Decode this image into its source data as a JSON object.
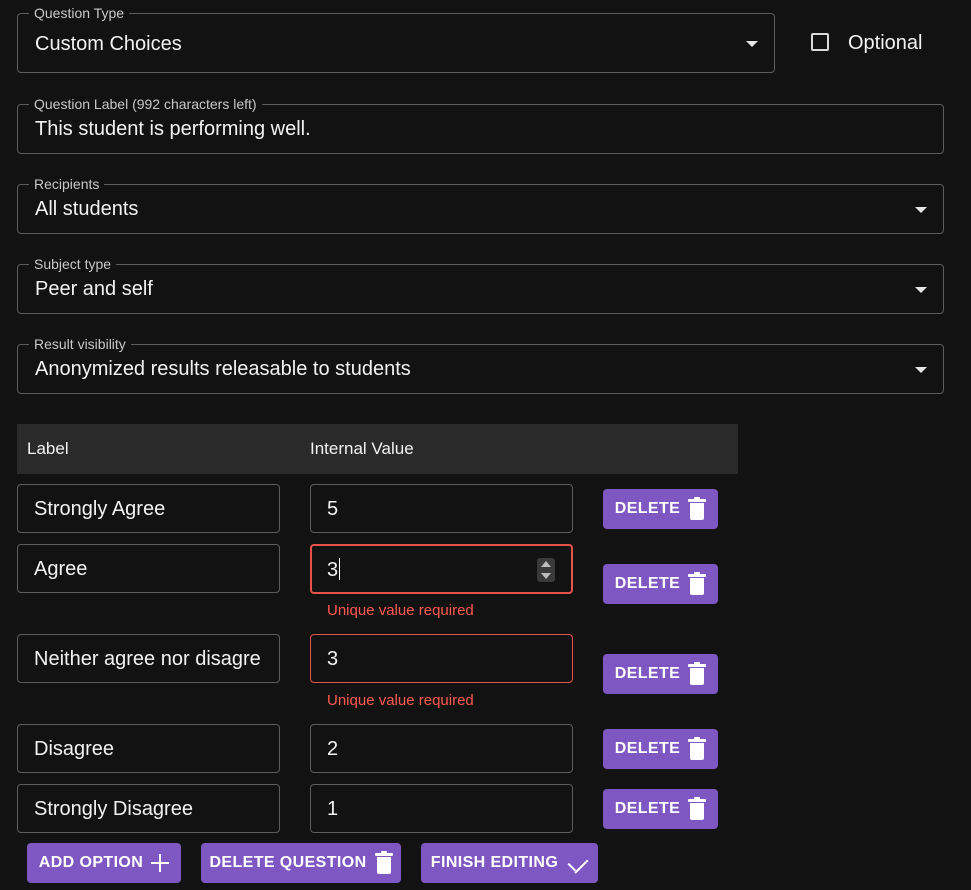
{
  "question_type": {
    "legend": "Question Type",
    "value": "Custom Choices",
    "icon": "chevron-down-icon"
  },
  "optional": {
    "label": "Optional",
    "checked": false
  },
  "question_label": {
    "legend": "Question Label (992 characters left)",
    "value": "This student is performing well."
  },
  "recipients": {
    "legend": "Recipients",
    "value": "All students",
    "icon": "chevron-down-icon"
  },
  "subject_type": {
    "legend": "Subject type",
    "value": "Peer and self",
    "icon": "chevron-down-icon"
  },
  "result_visibility": {
    "legend": "Result visibility",
    "value": "Anonymized results releasable to students",
    "icon": "chevron-down-icon"
  },
  "table": {
    "headers": {
      "label": "Label",
      "internal_value": "Internal Value"
    },
    "rows": [
      {
        "label": "Strongly Agree",
        "value": "5",
        "error": "",
        "delete_label": "DELETE"
      },
      {
        "label": "Agree",
        "value": "3",
        "error": "Unique value required",
        "delete_label": "DELETE"
      },
      {
        "label": "Neither agree nor disagre",
        "value": "3",
        "error": "Unique value required",
        "delete_label": "DELETE"
      },
      {
        "label": "Disagree",
        "value": "2",
        "error": "",
        "delete_label": "DELETE"
      },
      {
        "label": "Strongly Disagree",
        "value": "1",
        "error": "",
        "delete_label": "DELETE"
      }
    ]
  },
  "actions": {
    "add_option": "ADD OPTION",
    "delete_question": "DELETE QUESTION",
    "finish_editing": "FINISH EDITING"
  },
  "colors": {
    "accent": "#7e57c2",
    "error": "#e5534b",
    "background": "#121212"
  }
}
